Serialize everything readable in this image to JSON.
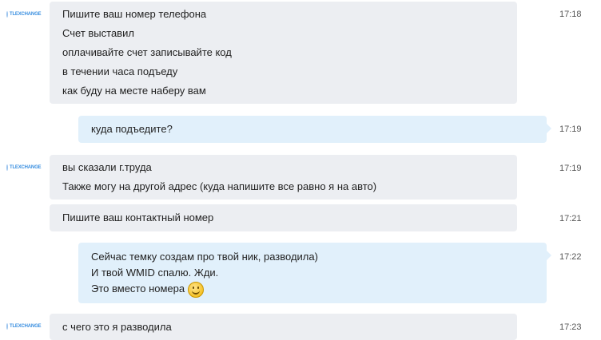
{
  "avatar": {
    "brand": "TLEXCHANGE"
  },
  "messages": [
    {
      "lines": [
        "Пишите ваш номер телефона",
        "Счет выставил",
        "оплачивайте счет записывайте код",
        "в течении часа подъеду",
        "как буду на месте наберу вам"
      ],
      "time": "17:18"
    },
    {
      "lines": [
        "куда подъедите?"
      ],
      "time": "17:19"
    },
    {
      "lines": [
        "вы сказали г.труда",
        "Также могу на другой адрес (куда напишите все равно я на авто)"
      ],
      "time": "17:19"
    },
    {
      "lines": [
        "Пишите ваш контактный номер"
      ],
      "time": "17:21"
    },
    {
      "lines": [
        "Сейчас темку создам про твой ник, разводила)",
        "И твой WMID спалю. Жди.",
        "Это вместо номера"
      ],
      "time": "17:22",
      "emoji": "smile-emoji"
    },
    {
      "lines": [
        "с чего это я разводила"
      ],
      "time": "17:23"
    }
  ]
}
